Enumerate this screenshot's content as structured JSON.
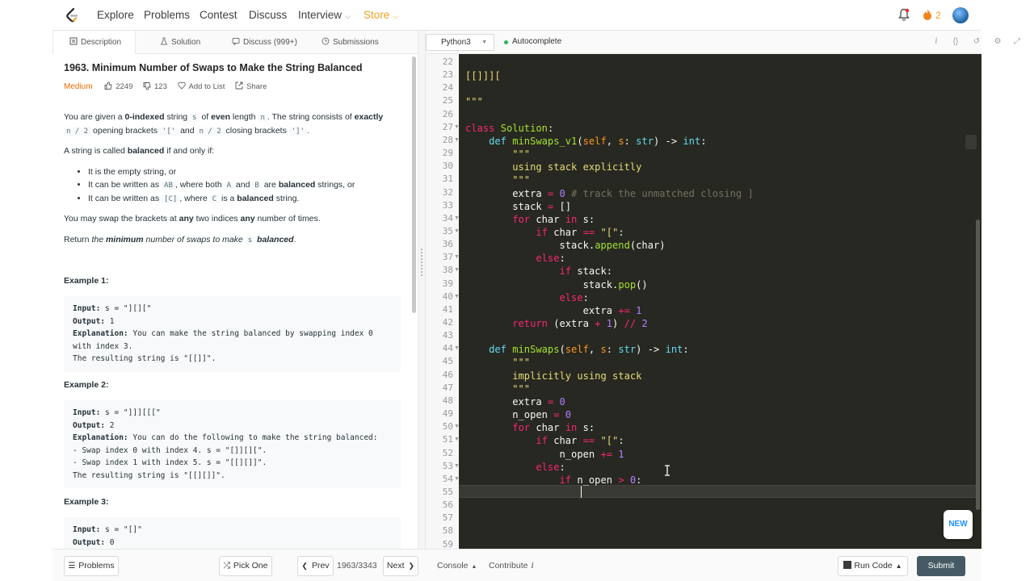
{
  "nav": {
    "items": [
      "Explore",
      "Problems",
      "Contest",
      "Discuss",
      "Interview",
      "Store"
    ],
    "fire_count": "2"
  },
  "left_tabs": [
    "Description",
    "Solution",
    "Discuss (999+)",
    "Submissions"
  ],
  "problem": {
    "title": "1963. Minimum Number of Swaps to Make the String Balanced",
    "difficulty": "Medium",
    "likes": "2249",
    "dislikes": "123",
    "add_to_list": "Add to List",
    "share": "Share",
    "p1_a": "You are given a ",
    "p1_b": "0-indexed",
    "p1_c": " string ",
    "p1_code_s": "s",
    "p1_d": " of ",
    "p1_e": "even",
    "p1_f": " length ",
    "p1_code_n": "n",
    "p1_g": ". The string consists of ",
    "p1_h": "exactly",
    "p1_code_n2a": "n / 2",
    "p1_i": " opening brackets ",
    "p1_code_open": "'['",
    "p1_j": " and ",
    "p1_code_n2b": "n / 2",
    "p1_k": " closing brackets ",
    "p1_code_close": "']'",
    "p1_l": ".",
    "p2_a": "A string is called ",
    "p2_b": "balanced",
    "p2_c": " if and only if:",
    "li1": "It is the empty string, or",
    "li2_a": "It can be written as ",
    "li2_code_ab": "AB",
    "li2_b": ", where both ",
    "li2_code_a": "A",
    "li2_c": " and ",
    "li2_code_b": "B",
    "li2_d": " are ",
    "li2_e": "balanced",
    "li2_f": " strings, or",
    "li3_a": "It can be written as ",
    "li3_code_c1": "[C]",
    "li3_b": ", where ",
    "li3_code_c2": "C",
    "li3_c": " is a ",
    "li3_d": "balanced",
    "li3_e": " string.",
    "p3_a": "You may swap the brackets at ",
    "p3_b": "any",
    "p3_c": " two indices ",
    "p3_d": "any",
    "p3_e": " number of times.",
    "p4_a": "Return ",
    "p4_b": "the ",
    "p4_c": "minimum",
    "p4_d": " number of swaps to make ",
    "p4_code_s": "s",
    "p4_e": " balanced",
    "p4_f": "."
  },
  "examples": [
    {
      "heading": "Example 1:",
      "input_label": "Input:",
      "input": " s = \"][][\"",
      "output_label": "Output:",
      "output": " 1",
      "expl_label": "Explanation:",
      "expl": " You can make the string balanced by swapping index 0",
      "extra1": "with index 3.",
      "extra2": "The resulting string is \"[[]]\"."
    },
    {
      "heading": "Example 2:",
      "input_label": "Input:",
      "input": " s = \"]]][[[\"",
      "output_label": "Output:",
      "output": " 2",
      "expl_label": "Explanation:",
      "expl": " You can do the following to make the string balanced:",
      "extra1": "- Swap index 0 with index 4. s = \"[]][][\".",
      "extra2": "- Swap index 1 with index 5. s = \"[[][]]\".",
      "extra3": "The resulting string is \"[[][]]\"."
    },
    {
      "heading": "Example 3:",
      "input_label": "Input:",
      "input": " s = \"[]\"",
      "output_label": "Output:",
      "output": " 0"
    }
  ],
  "editor": {
    "language": "Python3",
    "autocomplete": "Autocomplete",
    "line_numbers": [
      "22",
      "23",
      "24",
      "25",
      "26",
      "27",
      "28",
      "29",
      "30",
      "31",
      "32",
      "33",
      "34",
      "35",
      "36",
      "37",
      "38",
      "39",
      "40",
      "41",
      "42",
      "43",
      "44",
      "45",
      "46",
      "47",
      "48",
      "49",
      "50",
      "51",
      "52",
      "53",
      "54",
      "55",
      "56",
      "57",
      "58",
      "59"
    ],
    "fold_markers": [
      "27",
      "28",
      "34",
      "35",
      "37",
      "38",
      "40",
      "44",
      "50",
      "51",
      "53",
      "54"
    ],
    "code": [
      [],
      [
        [
          "st",
          "[[]]]["
        ]
      ],
      [],
      [
        [
          "st",
          "\"\"\""
        ]
      ],
      [],
      [
        [
          "kw",
          "class "
        ],
        [
          "fn",
          "Solution"
        ],
        [
          "",
          ":"
        ]
      ],
      [
        [
          "",
          "    "
        ],
        [
          "df",
          "def "
        ],
        [
          "fn",
          "minSwaps_v1"
        ],
        [
          "",
          "("
        ],
        [
          "pm",
          "self"
        ],
        [
          "",
          ", "
        ],
        [
          "pm",
          "s"
        ],
        [
          "",
          ": "
        ],
        [
          "bi",
          "str"
        ],
        [
          "",
          ") -> "
        ],
        [
          "bi",
          "int"
        ],
        [
          "",
          ":"
        ]
      ],
      [
        [
          "",
          "        "
        ],
        [
          "st",
          "\"\"\""
        ]
      ],
      [
        [
          "",
          "        "
        ],
        [
          "st",
          "using stack explicitly"
        ]
      ],
      [
        [
          "",
          "        "
        ],
        [
          "st",
          "\"\"\""
        ]
      ],
      [
        [
          "",
          "        extra "
        ],
        [
          "kw",
          "="
        ],
        [
          "nm",
          " 0"
        ],
        [
          "cm",
          " # track the unmatched closing ]"
        ]
      ],
      [
        [
          "",
          "        stack "
        ],
        [
          "kw",
          "="
        ],
        [
          "",
          " []"
        ]
      ],
      [
        [
          "",
          "        "
        ],
        [
          "kw",
          "for"
        ],
        [
          "",
          " char "
        ],
        [
          "kw",
          "in"
        ],
        [
          "",
          " s:"
        ]
      ],
      [
        [
          "",
          "            "
        ],
        [
          "kw",
          "if"
        ],
        [
          "",
          " char "
        ],
        [
          "kw",
          "=="
        ],
        [
          "st",
          " \"[\""
        ],
        [
          "",
          ":"
        ]
      ],
      [
        [
          "",
          "                stack."
        ],
        [
          "fn",
          "append"
        ],
        [
          "",
          "(char)"
        ]
      ],
      [
        [
          "",
          "            "
        ],
        [
          "kw",
          "else"
        ],
        [
          "",
          ":"
        ]
      ],
      [
        [
          "",
          "                "
        ],
        [
          "kw",
          "if"
        ],
        [
          "",
          " stack:"
        ]
      ],
      [
        [
          "",
          "                    stack."
        ],
        [
          "fn",
          "pop"
        ],
        [
          "",
          "()"
        ]
      ],
      [
        [
          "",
          "                "
        ],
        [
          "kw",
          "else"
        ],
        [
          "",
          ":"
        ]
      ],
      [
        [
          "",
          "                    extra "
        ],
        [
          "kw",
          "+="
        ],
        [
          "nm",
          " 1"
        ]
      ],
      [
        [
          "",
          "        "
        ],
        [
          "kw",
          "return"
        ],
        [
          "",
          " (extra "
        ],
        [
          "kw",
          "+"
        ],
        [
          "nm",
          " 1"
        ],
        [
          "",
          ") "
        ],
        [
          "kw",
          "//"
        ],
        [
          "nm",
          " 2"
        ]
      ],
      [],
      [
        [
          "",
          "    "
        ],
        [
          "df",
          "def "
        ],
        [
          "fn",
          "minSwaps"
        ],
        [
          "",
          "("
        ],
        [
          "pm",
          "self"
        ],
        [
          "",
          ", "
        ],
        [
          "pm",
          "s"
        ],
        [
          "",
          ": "
        ],
        [
          "bi",
          "str"
        ],
        [
          "",
          ") -> "
        ],
        [
          "bi",
          "int"
        ],
        [
          "",
          ":"
        ]
      ],
      [
        [
          "",
          "        "
        ],
        [
          "st",
          "\"\"\""
        ]
      ],
      [
        [
          "",
          "        "
        ],
        [
          "st",
          "implicitly using stack"
        ]
      ],
      [
        [
          "",
          "        "
        ],
        [
          "st",
          "\"\"\""
        ]
      ],
      [
        [
          "",
          "        extra "
        ],
        [
          "kw",
          "="
        ],
        [
          "nm",
          " 0"
        ]
      ],
      [
        [
          "",
          "        n_open "
        ],
        [
          "kw",
          "="
        ],
        [
          "nm",
          " 0"
        ]
      ],
      [
        [
          "",
          "        "
        ],
        [
          "kw",
          "for"
        ],
        [
          "",
          " char "
        ],
        [
          "kw",
          "in"
        ],
        [
          "",
          " s:"
        ]
      ],
      [
        [
          "",
          "            "
        ],
        [
          "kw",
          "if"
        ],
        [
          "",
          " char "
        ],
        [
          "kw",
          "=="
        ],
        [
          "st",
          " \"[\""
        ],
        [
          "",
          ":"
        ]
      ],
      [
        [
          "",
          "                n_open "
        ],
        [
          "kw",
          "+="
        ],
        [
          "nm",
          " 1"
        ]
      ],
      [
        [
          "",
          "            "
        ],
        [
          "kw",
          "else"
        ],
        [
          "",
          ":"
        ]
      ],
      [
        [
          "",
          "                "
        ],
        [
          "kw",
          "if"
        ],
        [
          "",
          " n_open "
        ],
        [
          "kw",
          ">"
        ],
        [
          "nm",
          " 0"
        ],
        [
          "",
          ":"
        ]
      ],
      [],
      [],
      [],
      [],
      []
    ]
  },
  "new_badge": "NEW",
  "footer": {
    "problems": "Problems",
    "pick_one": "Pick One",
    "prev": "Prev",
    "counter": "1963/3343",
    "next": "Next",
    "console": "Console",
    "contribute": "Contribute",
    "run_code": "Run Code",
    "submit": "Submit"
  }
}
